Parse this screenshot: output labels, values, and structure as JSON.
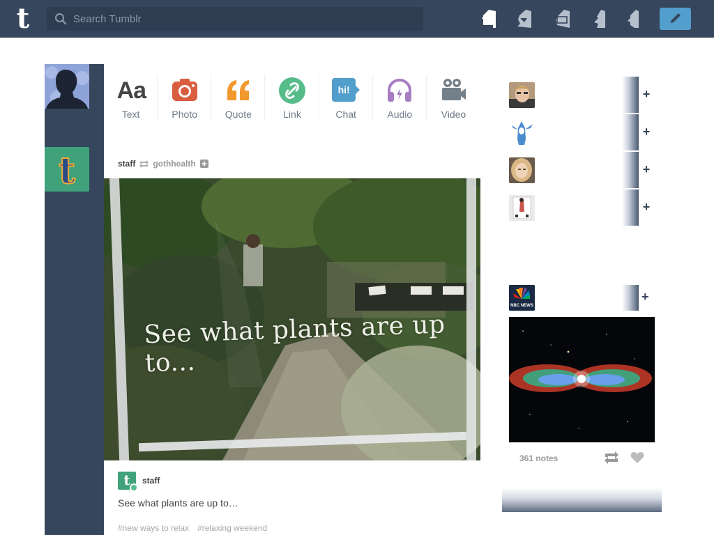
{
  "header": {
    "logo": "t",
    "search_placeholder": "Search Tumblr",
    "nav_icons": [
      "dashboard-icon",
      "explore-icon",
      "inbox-icon",
      "activity-icon",
      "account-icon"
    ],
    "compose_icon": "pencil-icon"
  },
  "post_types": [
    {
      "label": "Text",
      "glyph": "Aa",
      "color": "#444444"
    },
    {
      "label": "Photo",
      "color": "#d95e40"
    },
    {
      "label": "Quote",
      "glyph": "“",
      "color": "#f2992e"
    },
    {
      "label": "Link",
      "color": "#56bc8a"
    },
    {
      "label": "Chat",
      "glyph": "hi!",
      "color": "#529ecc"
    },
    {
      "label": "Audio",
      "color": "#a77dc2"
    },
    {
      "label": "Video",
      "color": "#748089"
    }
  ],
  "post": {
    "author": "staff",
    "reblogged_from": "gothhealth",
    "image_caption": "See what plants are up to...",
    "reblog_author": "staff",
    "reblog_avatar": "t",
    "text": "See what plants are up to…",
    "tags": [
      "#new ways to relax",
      "#relaxing weekend"
    ]
  },
  "sidebar": {
    "recommended": [
      {
        "avatar": "avatar-man-selfie"
      },
      {
        "avatar": "avatar-shark-costume"
      },
      {
        "avatar": "avatar-blonde-woman"
      },
      {
        "avatar": "avatar-playing-card"
      }
    ],
    "radar": {
      "avatar": "nbc-news-logo",
      "avatar_text": "NBC NEWS",
      "notes": "361 notes"
    }
  },
  "colors": {
    "navy": "#36465d",
    "compose": "#529ecc",
    "tumblr_green": "#3fa27a"
  }
}
